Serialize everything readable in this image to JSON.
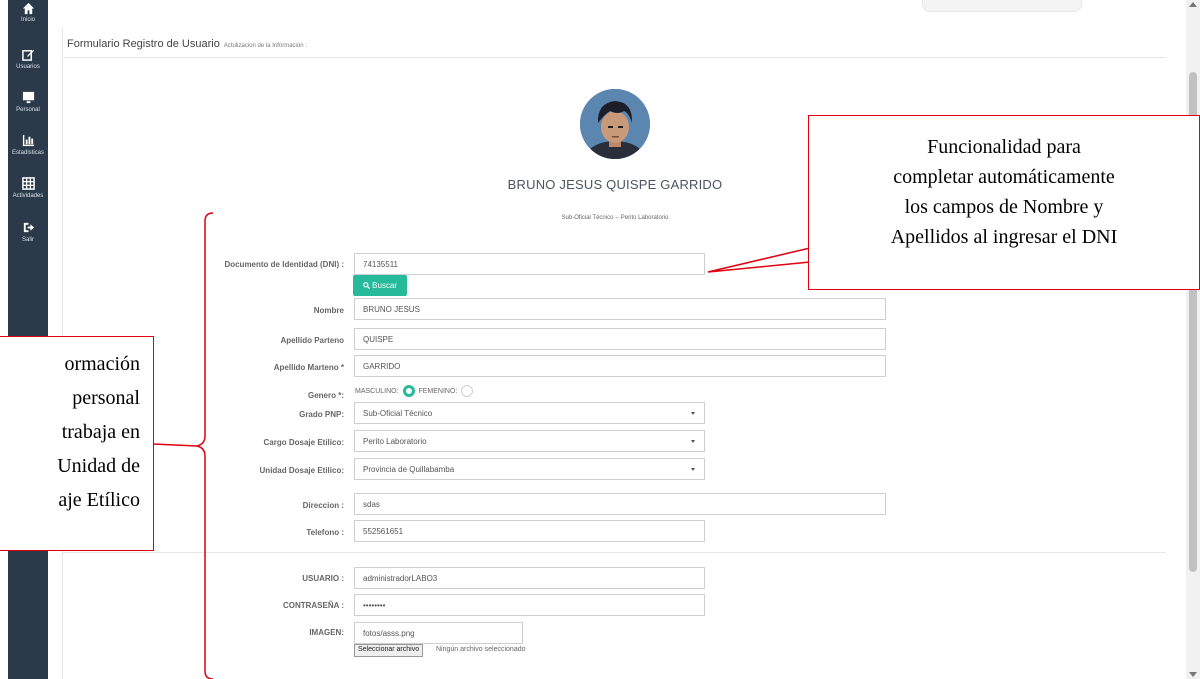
{
  "sidebar": {
    "items": [
      {
        "label": "Inicio",
        "icon": "home-icon"
      },
      {
        "label": "Usuarios",
        "icon": "edit-icon"
      },
      {
        "label": "Personal",
        "icon": "monitor-icon"
      },
      {
        "label": "Estadisticas",
        "icon": "bar-chart-icon"
      },
      {
        "label": "Actividades",
        "icon": "table-icon"
      },
      {
        "label": "Salir",
        "icon": "sign-out-icon"
      }
    ]
  },
  "header": {
    "title": "Formulario Registro de Usuario",
    "subtitle": "Actulizacion de la Informacion :"
  },
  "profile": {
    "full_name": "BRUNO JESUS QUISPE GARRIDO",
    "role": "Sub-Oficial Técnico -- Perito Laboratorio"
  },
  "form": {
    "dni_label": "Documento de Identidad (DNI) :",
    "dni_value": "74135511",
    "search_button": "Buscar",
    "nombre_label": "Nombre",
    "nombre_value": "BRUNO JESUS",
    "paterno_label": "Apellido Parteno",
    "paterno_value": "QUISPE",
    "materno_label": "Apellido Marteno *",
    "materno_value": "GARRIDO",
    "genero_label": "Genero *:",
    "genero_masculino": "MASCULINO:",
    "genero_femenino": "FEMENINO:",
    "genero_selected": "MASCULINO",
    "grado_label": "Grado PNP:",
    "grado_value": "Sub-Oficial Técnico",
    "cargo_label": "Cargo Dosaje Etilico:",
    "cargo_value": "Perito Laboratorio",
    "unidad_label": "Unidad Dosaje Etilico:",
    "unidad_value": "Provincia de Quillabamba",
    "direccion_label": "Direccion :",
    "direccion_value": "sdas",
    "telefono_label": "Telefono :",
    "telefono_value": "552561651",
    "usuario_label": "USUARIO :",
    "usuario_value": "administradorLABO3",
    "contrasena_label": "CONTRASEÑA :",
    "contrasena_value": "••••••••",
    "imagen_label": "IMAGEN:",
    "imagen_value": "fotos/asss.png",
    "file_button": "Seleccionar archivo",
    "file_status": "Ningún archivo seleccionado"
  },
  "callouts": {
    "right_lines": [
      "Funcionalidad para",
      "completar automáticamente",
      "los campos de Nombre y",
      "Apellidos al ingresar el DNI"
    ],
    "left_lines": [
      "ormación",
      "personal",
      "trabaja en",
      "Unidad de",
      "aje Etílico"
    ]
  },
  "colors": {
    "sidebar_bg": "#2b3a4a",
    "accent_green": "#26b99a",
    "callout_red": "#e0000f"
  }
}
